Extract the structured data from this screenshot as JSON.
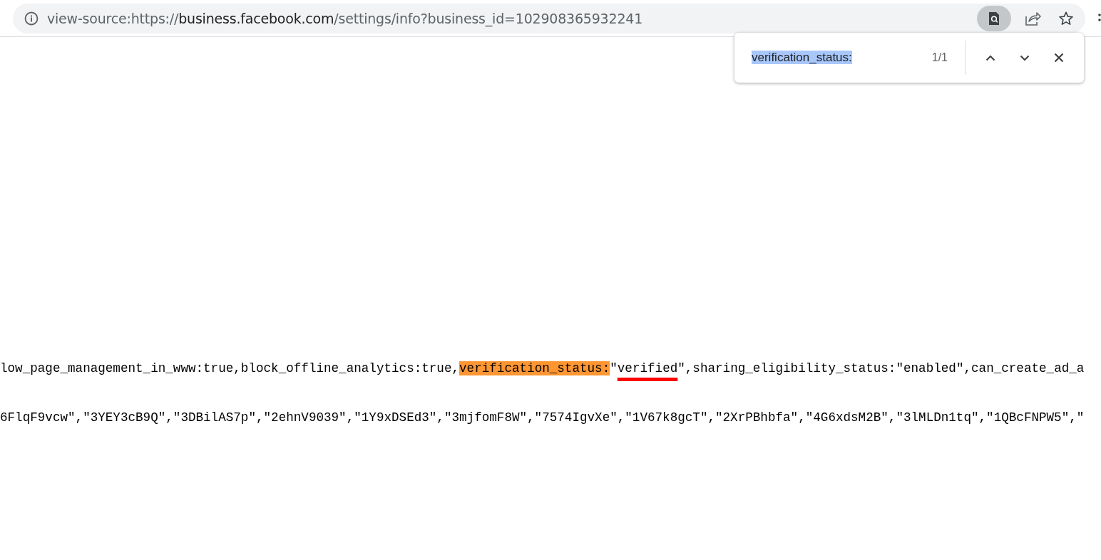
{
  "address_bar": {
    "url_parts": [
      {
        "text": "view-source:https://",
        "kind": "dim"
      },
      {
        "text": "business.facebook.com",
        "kind": "host"
      },
      {
        "text": "/settings/info?business_id=102908365932241",
        "kind": "dim"
      }
    ]
  },
  "toolbar": {
    "find_in_page_active": true
  },
  "find_bar": {
    "value": "verification_status:",
    "count": "1/1"
  },
  "source_lines": [
    {
      "segments": [
        {
          "text": "low_page_management_in_www:true,block_offline_analytics:true,",
          "kind": "plain"
        },
        {
          "text": "verification_status:",
          "kind": "match"
        },
        {
          "text": "\"",
          "kind": "plain"
        },
        {
          "text": "verified",
          "kind": "underlined"
        },
        {
          "text": "\",sharing_eligibility_status:\"enabled\",can_create_ad_a",
          "kind": "plain"
        }
      ]
    },
    {
      "segments": [
        {
          "text": "6FlqF9vcw\",\"3YEY3cB9Q\",\"3DBilAS7p\",\"2ehnV9039\",\"1Y9xDSEd3\",\"3mjfomF8W\",\"7574IgvXe\",\"1V67k8gcT\",\"2XrPBhbfa\",\"4G6xdsM2B\",\"3lMLDn1tq\",\"1QBcFNPW5\",\"",
          "kind": "plain"
        }
      ]
    }
  ]
}
